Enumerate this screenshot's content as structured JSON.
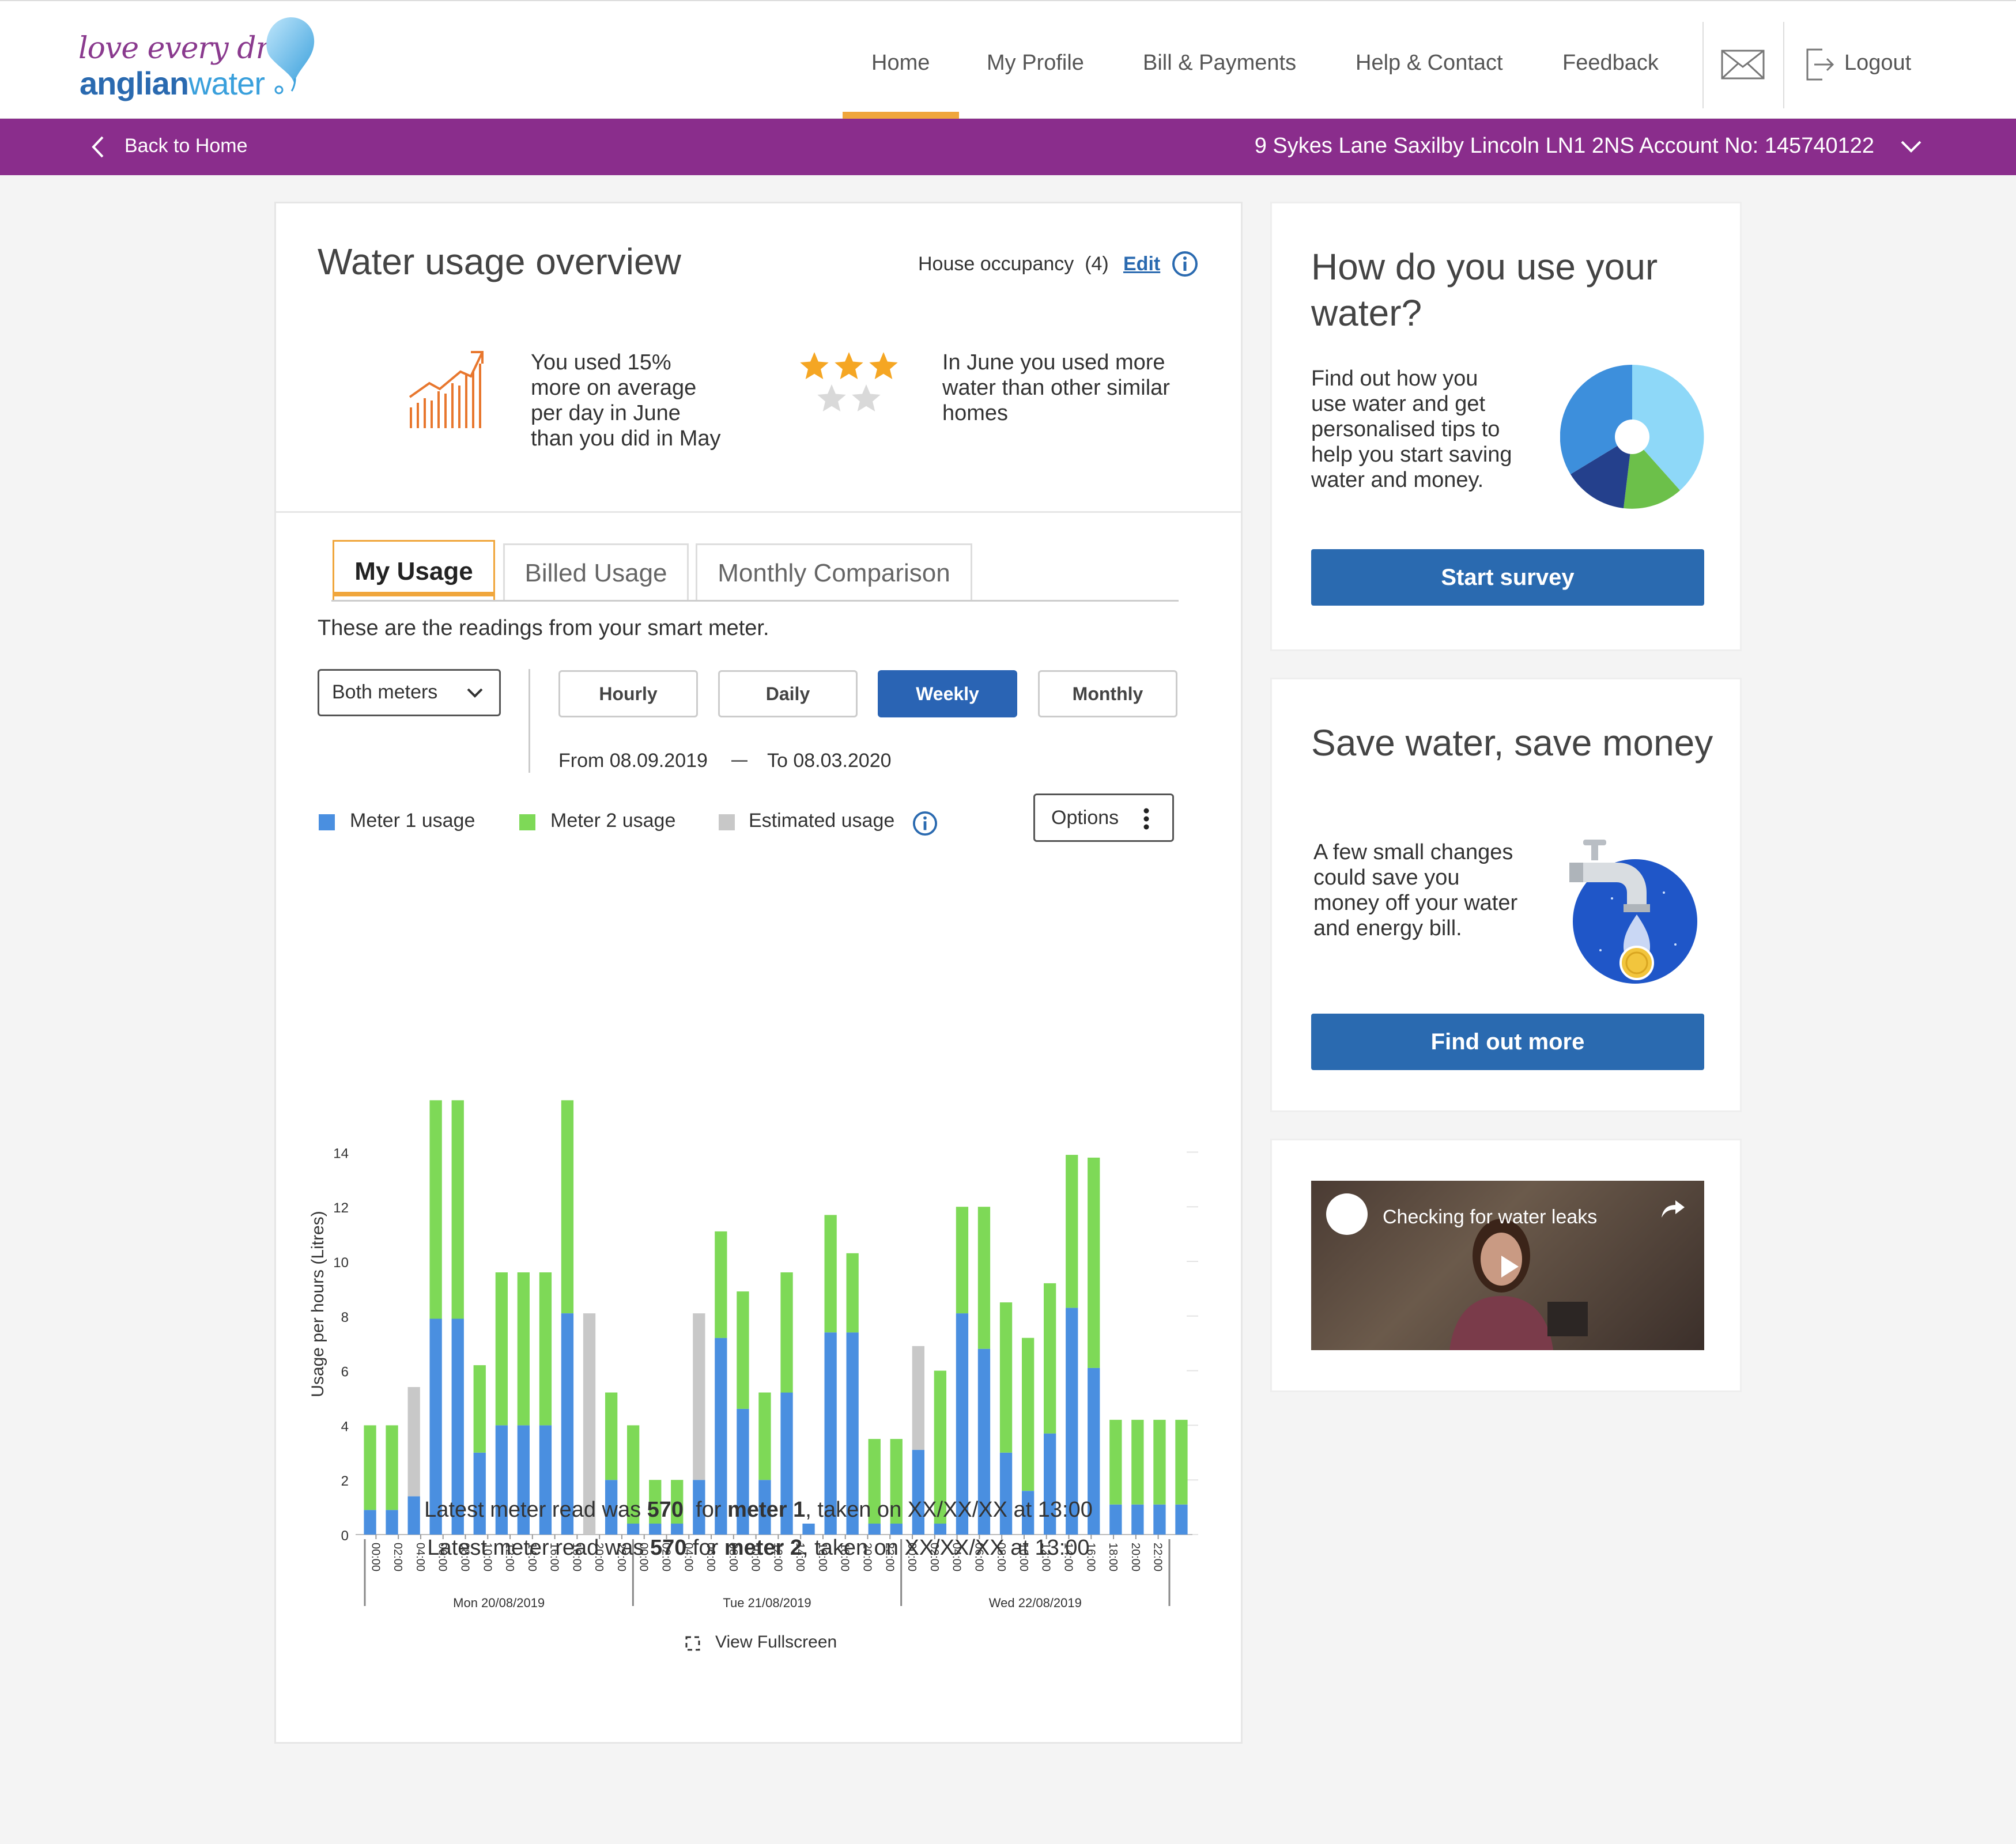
{
  "header": {
    "logo_line1": "love every drop",
    "logo_brand_bold": "anglian",
    "logo_brand_thin": "water",
    "nav": [
      "Home",
      "My Profile",
      "Bill & Payments",
      "Help & Contact",
      "Feedback"
    ],
    "logout": "Logout",
    "icons": [
      "mail-icon",
      "logout-icon"
    ],
    "accent_color": "#f0a63c"
  },
  "account_bar": {
    "back_label": "Back to Home",
    "address": "9 Sykes Lane Saxilby Lincoln LN1 2NS Account No: 145740122",
    "color": "#8a2d8c"
  },
  "overview": {
    "title": "Water usage overview",
    "occupancy_label": "House occupancy",
    "occupancy_value": "(4)",
    "edit_label": "Edit",
    "trend_text": "You used 15% more on average per day in June than you did in May",
    "stars_filled": 3,
    "stars_total": 5,
    "compare_text": "In June you used more water than other similar homes"
  },
  "tabs": [
    "My Usage",
    "Billed Usage",
    "Monthly Comparison"
  ],
  "active_tab": "My Usage",
  "readings_text": "These are the readings from your smart meter.",
  "meter_select": {
    "selected": "Both meters"
  },
  "periods": [
    "Hourly",
    "Daily",
    "Weekly",
    "Monthly"
  ],
  "active_period": "Weekly",
  "date_range": {
    "from": "From 08.09.2019",
    "to": "To 08.03.2020"
  },
  "legend": {
    "meter1": "Meter 1 usage",
    "meter2": "Meter 2 usage",
    "estimated": "Estimated usage",
    "colors": {
      "meter1": "#4a8fe0",
      "meter2": "#7ed957",
      "estimated": "#c8c8c8"
    }
  },
  "options_label": "Options",
  "chart_data": {
    "type": "bar",
    "stacked": true,
    "ylabel": "Usage per hours (Litres)",
    "ylim": [
      0,
      14
    ],
    "yticks": [
      0,
      2,
      4,
      6,
      8,
      10,
      12,
      14
    ],
    "categories": [
      "00:00",
      "02:00",
      "04:00",
      "06:00",
      "08:00",
      "10:00",
      "12:00",
      "14:00",
      "16:00",
      "18:00",
      "20:00",
      "22:00",
      "00:00",
      "02:00",
      "04:00",
      "06:00",
      "08:00",
      "10:00",
      "12:00",
      "14:00",
      "16:00",
      "18:00",
      "20:00",
      "22:00",
      "00:00",
      "02:00",
      "04:00",
      "06:00",
      "08:00",
      "10:00",
      "12:00",
      "14:00",
      "16:00",
      "18:00",
      "20:00",
      "22:00"
    ],
    "groups": [
      {
        "label": "Mon 20/08/2019",
        "start": 0,
        "end": 11
      },
      {
        "label": "Tue 21/08/2019",
        "start": 12,
        "end": 23
      },
      {
        "label": "Wed 22/08/2019",
        "start": 24,
        "end": 35
      }
    ],
    "slots_per_category": 2,
    "bars": [
      {
        "slot": 0,
        "meter1": 0.9,
        "meter2": 3.1,
        "estimated": 0
      },
      {
        "slot": 1,
        "meter1": 0.9,
        "meter2": 3.1,
        "estimated": 0
      },
      {
        "slot": 2,
        "meter1": 1.4,
        "meter2": 0,
        "estimated": 4.0
      },
      {
        "slot": 3,
        "meter1": 7.9,
        "meter2": 8.0,
        "estimated": 0
      },
      {
        "slot": 4,
        "meter1": 7.9,
        "meter2": 8.0,
        "estimated": 0
      },
      {
        "slot": 5,
        "meter1": 3.0,
        "meter2": 3.2,
        "estimated": 0
      },
      {
        "slot": 6,
        "meter1": 4.0,
        "meter2": 5.6,
        "estimated": 0
      },
      {
        "slot": 7,
        "meter1": 4.0,
        "meter2": 5.6,
        "estimated": 0
      },
      {
        "slot": 8,
        "meter1": 4.0,
        "meter2": 5.6,
        "estimated": 0
      },
      {
        "slot": 9,
        "meter1": 8.1,
        "meter2": 7.8,
        "estimated": 0
      },
      {
        "slot": 10,
        "meter1": 0,
        "meter2": 0,
        "estimated": 8.1
      },
      {
        "slot": 11,
        "meter1": 2.0,
        "meter2": 3.2,
        "estimated": 0
      },
      {
        "slot": 12,
        "meter1": 0.4,
        "meter2": 3.6,
        "estimated": 0
      },
      {
        "slot": 13,
        "meter1": 0.4,
        "meter2": 1.6,
        "estimated": 0
      },
      {
        "slot": 14,
        "meter1": 0.4,
        "meter2": 1.6,
        "estimated": 0
      },
      {
        "slot": 15,
        "meter1": 2.0,
        "meter2": 0,
        "estimated": 6.1
      },
      {
        "slot": 16,
        "meter1": 7.2,
        "meter2": 3.9,
        "estimated": 0
      },
      {
        "slot": 17,
        "meter1": 4.6,
        "meter2": 4.3,
        "estimated": 0
      },
      {
        "slot": 18,
        "meter1": 2.0,
        "meter2": 3.2,
        "estimated": 0
      },
      {
        "slot": 19,
        "meter1": 5.2,
        "meter2": 4.4,
        "estimated": 0
      },
      {
        "slot": 20,
        "meter1": 0.4,
        "meter2": 0,
        "estimated": 0
      },
      {
        "slot": 21,
        "meter1": 7.4,
        "meter2": 4.3,
        "estimated": 0
      },
      {
        "slot": 22,
        "meter1": 7.4,
        "meter2": 2.9,
        "estimated": 0
      },
      {
        "slot": 23,
        "meter1": 0.4,
        "meter2": 3.1,
        "estimated": 0
      },
      {
        "slot": 24,
        "meter1": 0.4,
        "meter2": 3.1,
        "estimated": 0
      },
      {
        "slot": 25,
        "meter1": 3.1,
        "meter2": 0,
        "estimated": 3.8
      },
      {
        "slot": 26,
        "meter1": 0.4,
        "meter2": 5.6,
        "estimated": 0
      },
      {
        "slot": 27,
        "meter1": 8.1,
        "meter2": 3.9,
        "estimated": 0
      },
      {
        "slot": 28,
        "meter1": 6.8,
        "meter2": 5.2,
        "estimated": 0
      },
      {
        "slot": 29,
        "meter1": 3.0,
        "meter2": 5.5,
        "estimated": 0
      },
      {
        "slot": 30,
        "meter1": 1.6,
        "meter2": 5.6,
        "estimated": 0
      },
      {
        "slot": 31,
        "meter1": 3.7,
        "meter2": 5.5,
        "estimated": 0
      },
      {
        "slot": 32,
        "meter1": 8.3,
        "meter2": 5.6,
        "estimated": 0
      },
      {
        "slot": 33,
        "meter1": 6.1,
        "meter2": 7.7,
        "estimated": 0
      },
      {
        "slot": 34,
        "meter1": 1.1,
        "meter2": 3.1,
        "estimated": 0
      },
      {
        "slot": 35,
        "meter1": 1.1,
        "meter2": 3.1,
        "estimated": 0
      },
      {
        "slot": 36,
        "meter1": 1.1,
        "meter2": 3.1,
        "estimated": 0
      },
      {
        "slot": 37,
        "meter1": 1.1,
        "meter2": 3.1,
        "estimated": 0
      }
    ]
  },
  "fullscreen_label": "View Fullscreen",
  "latest_reads": [
    {
      "prefix": "Latest meter read was ",
      "value": "570",
      "mid": "  for ",
      "meter": "meter 1",
      "suffix": ", taken on XX/XX/XX at 13:00"
    },
    {
      "prefix": "Latest meter read was ",
      "value": "570",
      "mid": " for ",
      "meter": "meter 2",
      "suffix": ", taken on XX/XX/XX at 13:00"
    }
  ],
  "sidebar": {
    "survey": {
      "title": "How do you use your water?",
      "text": "Find out how you use water and get personalised tips to help you start saving water and money.",
      "button": "Start survey"
    },
    "save": {
      "title": "Save water, save money",
      "text": "A few small changes could save you money off your water and energy bill.",
      "button": "Find out more"
    },
    "video": {
      "title": "Checking for water leaks"
    }
  }
}
